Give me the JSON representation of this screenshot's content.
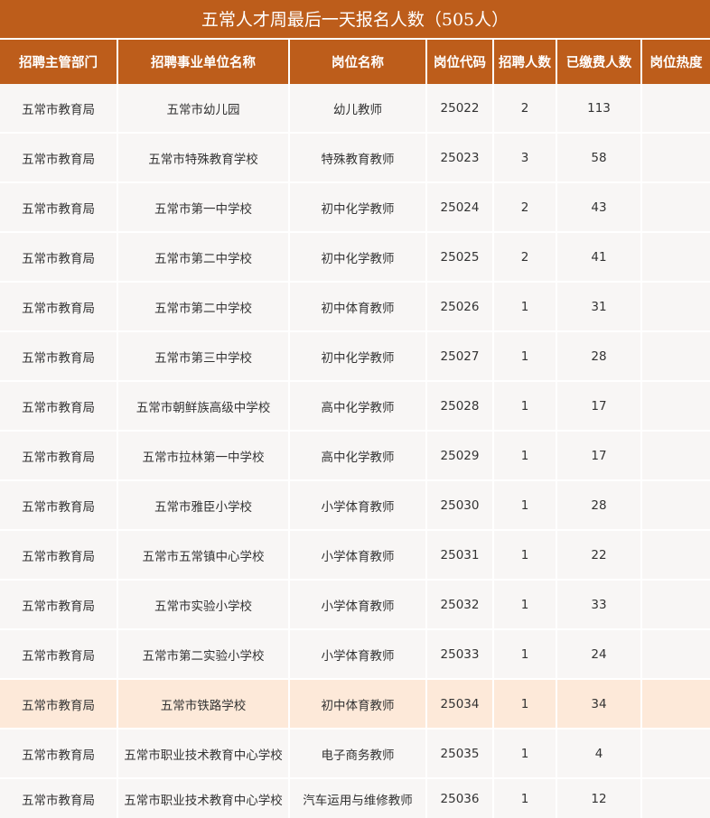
{
  "title": "五常人才周最后一天报名人数（505人）",
  "headers": [
    "招聘主管部门",
    "招聘事业单位名称",
    "岗位名称",
    "岗位代码",
    "招聘人数",
    "已缴费人数",
    "岗位热度"
  ],
  "rows": [
    [
      "五常市教育局",
      "五常市幼儿园",
      "幼儿教师",
      "25022",
      "2",
      "113",
      ""
    ],
    [
      "五常市教育局",
      "五常市特殊教育学校",
      "特殊教育教师",
      "25023",
      "3",
      "58",
      ""
    ],
    [
      "五常市教育局",
      "五常市第一中学校",
      "初中化学教师",
      "25024",
      "2",
      "43",
      ""
    ],
    [
      "五常市教育局",
      "五常市第二中学校",
      "初中化学教师",
      "25025",
      "2",
      "41",
      ""
    ],
    [
      "五常市教育局",
      "五常市第二中学校",
      "初中体育教师",
      "25026",
      "1",
      "31",
      ""
    ],
    [
      "五常市教育局",
      "五常市第三中学校",
      "初中化学教师",
      "25027",
      "1",
      "28",
      ""
    ],
    [
      "五常市教育局",
      "五常市朝鲜族高级中学校",
      "高中化学教师",
      "25028",
      "1",
      "17",
      ""
    ],
    [
      "五常市教育局",
      "五常市拉林第一中学校",
      "高中化学教师",
      "25029",
      "1",
      "17",
      ""
    ],
    [
      "五常市教育局",
      "五常市雅臣小学校",
      "小学体育教师",
      "25030",
      "1",
      "28",
      ""
    ],
    [
      "五常市教育局",
      "五常市五常镇中心学校",
      "小学体育教师",
      "25031",
      "1",
      "22",
      ""
    ],
    [
      "五常市教育局",
      "五常市实验小学校",
      "小学体育教师",
      "25032",
      "1",
      "33",
      ""
    ],
    [
      "五常市教育局",
      "五常市第二实验小学校",
      "小学体育教师",
      "25033",
      "1",
      "24",
      ""
    ],
    [
      "五常市教育局",
      "五常市铁路学校",
      "初中体育教师",
      "25034",
      "1",
      "34",
      ""
    ],
    [
      "五常市教育局",
      "五常市职业技术教育中心学校",
      "电子商务教师",
      "25035",
      "1",
      "4",
      ""
    ],
    [
      "五常市教育局",
      "五常市职业技术教育中心学校",
      "汽车运用与维修教师",
      "25036",
      "1",
      "12",
      ""
    ]
  ],
  "highlight_row": 12,
  "colors": {
    "header_bg": "#bd5d1b",
    "row_bg": "#f8f6f5",
    "highlight_bg": "#fde9d9"
  }
}
